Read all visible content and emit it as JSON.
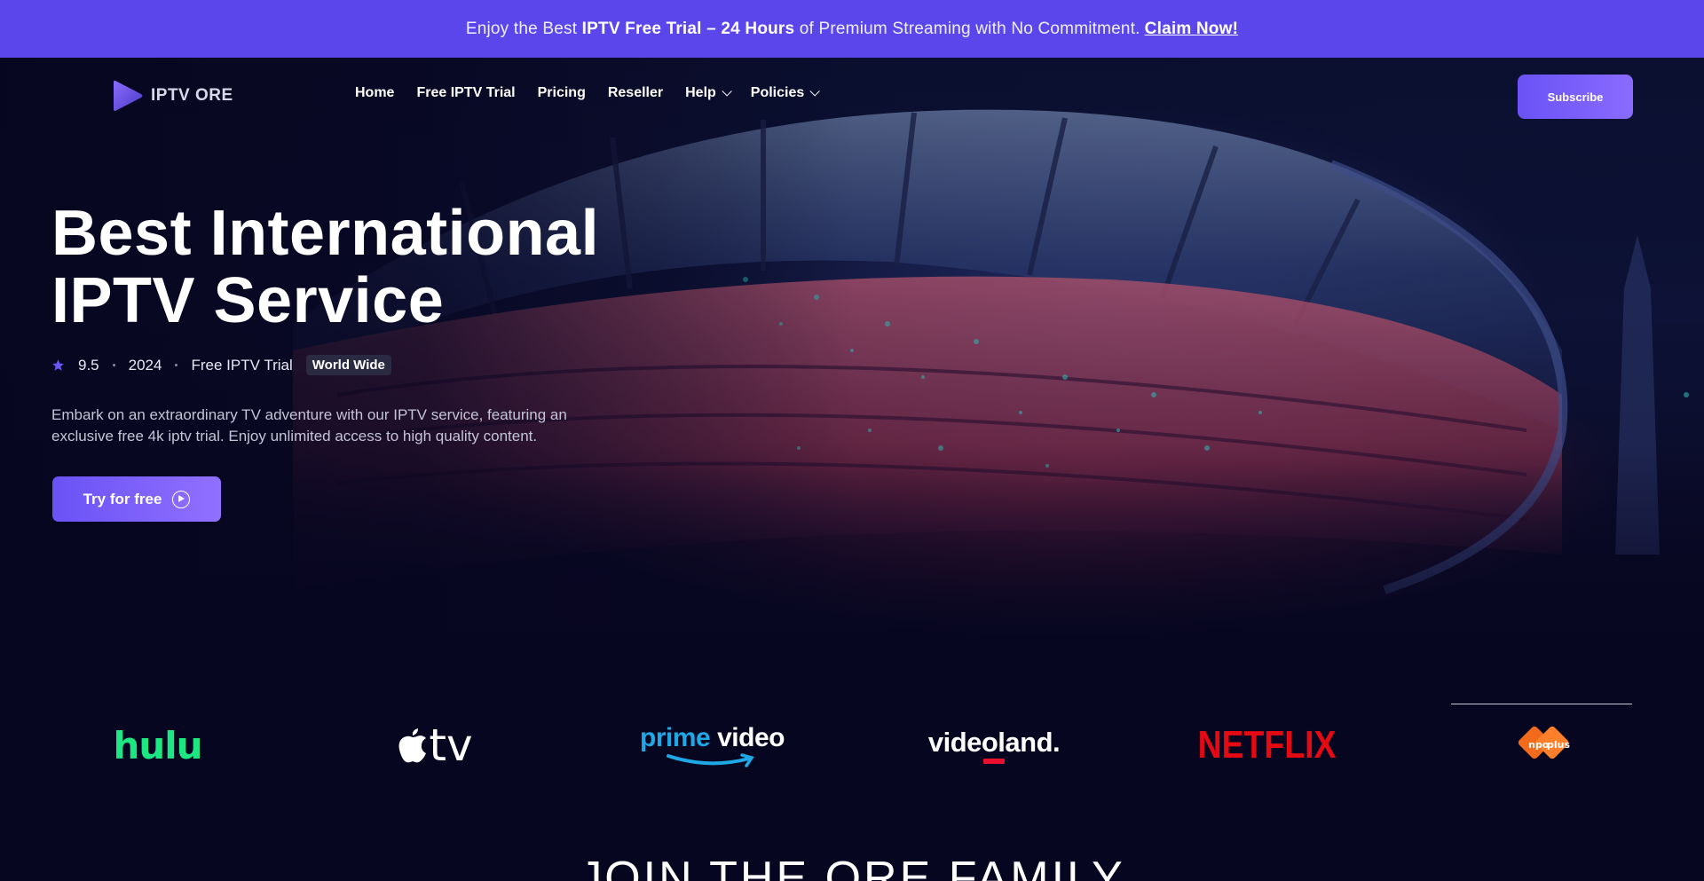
{
  "announcement": {
    "pre": "Enjoy the Best ",
    "bold": "IPTV Free Trial – 24 Hours",
    "post": " of Premium Streaming with No Commitment.",
    "link": "Claim Now!"
  },
  "header": {
    "logo_text": "IPTV ORE",
    "logo_icon": "play-triangle-icon",
    "nav": [
      "Home",
      "Free IPTV Trial",
      "Pricing",
      "Reseller",
      "Help",
      "Policies"
    ],
    "subscribe_label": "Subscribe"
  },
  "hero": {
    "title_line1": "Best International",
    "title_line2": "IPTV Service",
    "rating": "9.5",
    "year": "2024",
    "tag": "Free IPTV Trial",
    "badge": "World Wide",
    "description": "Embark on an extraordinary TV adventure with our IPTV service, featuring an exclusive free 4k iptv trial. Enjoy unlimited access to high quality content.",
    "cta_label": "Try for free"
  },
  "brands": {
    "hulu": "hulu",
    "appletv": "tv",
    "prime_a": "prime",
    "prime_b": "video",
    "videoland": "videoland.",
    "netflix": "NETFLIX",
    "npo": "npo plus"
  },
  "section_heading": "JOIN THE ORE FAMILY",
  "colors": {
    "announce_bg": "#5b46ec",
    "accent": "#6a52f5",
    "page_bg": "#070620",
    "hulu_green": "#1ce783",
    "netflix_red": "#e50914"
  }
}
